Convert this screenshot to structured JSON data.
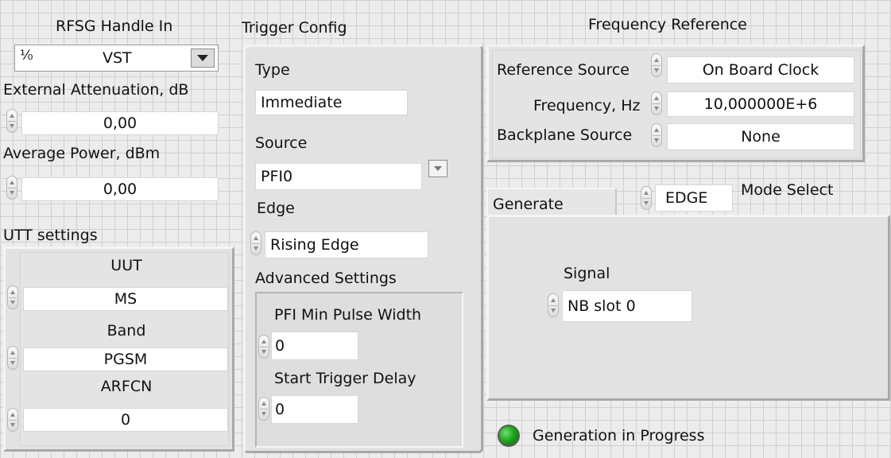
{
  "rfsg": {
    "title": "RFSG Handle In",
    "icon": "io-handle-icon",
    "icon_glyph": "⅟₀",
    "value": "VST"
  },
  "external_attenuation": {
    "label": "External Attenuation, dB",
    "value": "0,00"
  },
  "average_power": {
    "label": "Average Power, dBm",
    "value": "0,00"
  },
  "utt": {
    "title": "UTT settings",
    "uut_label": "UUT",
    "uut_value": "MS",
    "band_label": "Band",
    "band_value": "PGSM",
    "arfcn_label": "ARFCN",
    "arfcn_value": "0"
  },
  "trigger": {
    "title": "Trigger Config",
    "type_label": "Type",
    "type_value": "Immediate",
    "source_label": "Source",
    "source_value": "PFI0",
    "edge_label": "Edge",
    "edge_value": "Rising Edge",
    "advanced_label": "Advanced Settings",
    "pfi_min_label": "PFI Min Pulse Width",
    "pfi_min_value": "0",
    "start_delay_label": "Start Trigger Delay",
    "start_delay_value": "0"
  },
  "freq_ref": {
    "title": "Frequency Reference",
    "ref_source_label": "Reference Source",
    "ref_source_value": "On Board Clock",
    "frequency_label": "Frequency, Hz",
    "frequency_value": "10,000000E+6",
    "backplane_label": "Backplane Source",
    "backplane_value": "None"
  },
  "mode": {
    "label": "Mode Select",
    "value": "EDGE"
  },
  "generate": {
    "tab_label": "Generate",
    "signal_label": "Signal",
    "signal_value": "NB slot 0"
  },
  "status": {
    "label": "Generation in Progress",
    "led_color": "#1ea81e",
    "led_on": true
  },
  "colors": {
    "panel_bg": "#ececec",
    "grid": "#cfcfcf",
    "field_bg": "#ffffff"
  }
}
